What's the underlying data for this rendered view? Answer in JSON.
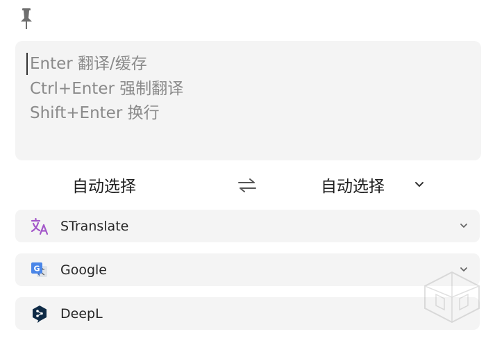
{
  "toolbar": {
    "pin_icon": "pin-icon"
  },
  "input": {
    "value": "",
    "placeholder": "Enter 翻译/缓存\nCtrl+Enter 强制翻译\nShift+Enter 换行"
  },
  "languages": {
    "source": "自动选择",
    "target": "自动选择",
    "swap_icon": "swap-arrows-icon"
  },
  "services": [
    {
      "name": "STranslate",
      "icon": "stranslate-icon",
      "expandable": true
    },
    {
      "name": "Google",
      "icon": "google-translate-icon",
      "expandable": true
    },
    {
      "name": "DeepL",
      "icon": "deepl-icon",
      "expandable": false
    }
  ],
  "colors": {
    "panel_bg": "#f4f4f4",
    "stranslate_accent": "#a357c9",
    "google_blue": "#4a86e8",
    "deepl_navy": "#0f2b46"
  }
}
